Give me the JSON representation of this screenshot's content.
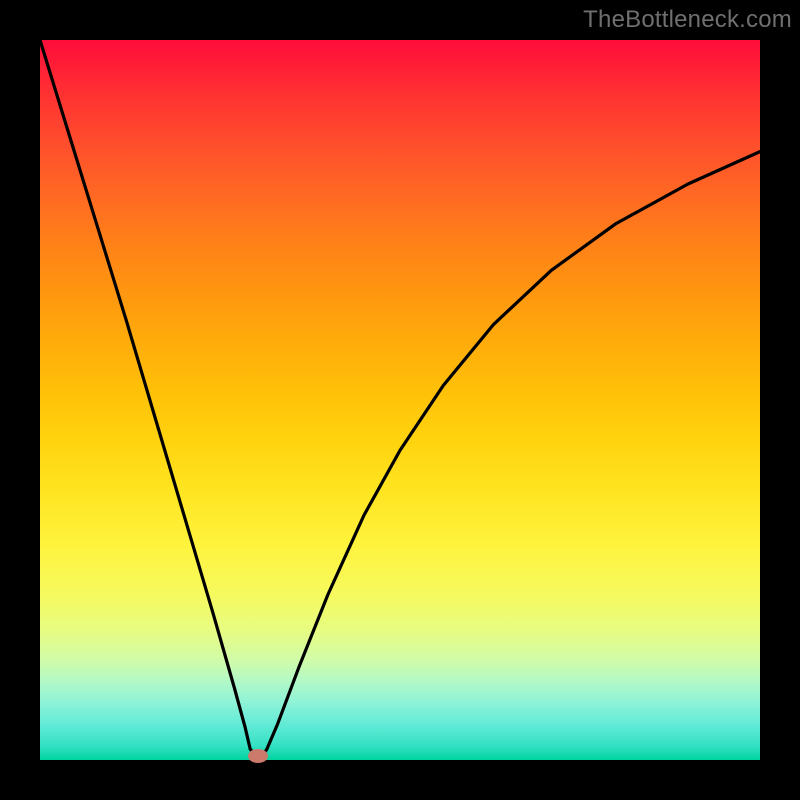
{
  "attribution": "TheBottleneck.com",
  "colors": {
    "marker": "#cc7a6b",
    "curve": "#000000",
    "frame": "#000000"
  },
  "marker": {
    "x_pct": 30.3,
    "y_pct": 99.4
  },
  "chart_data": {
    "type": "line",
    "title": "",
    "xlabel": "",
    "ylabel": "",
    "xlim": [
      0,
      100
    ],
    "ylim": [
      0,
      100
    ],
    "grid": false,
    "legend": false,
    "series": [
      {
        "name": "bottleneck-curve",
        "x": [
          0,
          4,
          8,
          12,
          16,
          20,
          24,
          27,
          28.5,
          29.2,
          30.5,
          31.5,
          33,
          36,
          40,
          45,
          50,
          56,
          63,
          71,
          80,
          90,
          100
        ],
        "values": [
          100,
          87,
          74,
          61,
          47.5,
          34,
          20.5,
          10,
          4.5,
          1.5,
          0,
          1.5,
          5,
          13,
          23,
          34,
          43,
          52,
          60.5,
          68,
          74.5,
          80,
          84.5
        ]
      }
    ],
    "annotations": [
      {
        "type": "marker",
        "x": 30.3,
        "y": 0.6,
        "color": "#cc7a6b"
      }
    ],
    "background_gradient": "red-yellow-green (top to bottom)"
  }
}
